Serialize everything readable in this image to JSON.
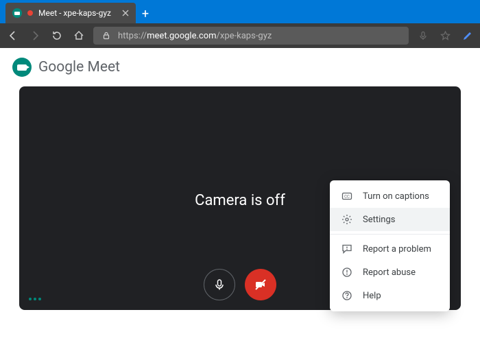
{
  "browser": {
    "tab_title": "Meet - xpe-kaps-gyz",
    "url_protocol": "https://",
    "url_host": "meet.google.com",
    "url_path": "/xpe-kaps-gyz"
  },
  "brand": {
    "name_html_prefix": "Google",
    "name_html_suffix": " Meet"
  },
  "stage": {
    "camera_off_text": "Camera is off"
  },
  "menu": {
    "captions": "Turn on captions",
    "settings": "Settings",
    "report_problem": "Report a problem",
    "report_abuse": "Report abuse",
    "help": "Help"
  }
}
